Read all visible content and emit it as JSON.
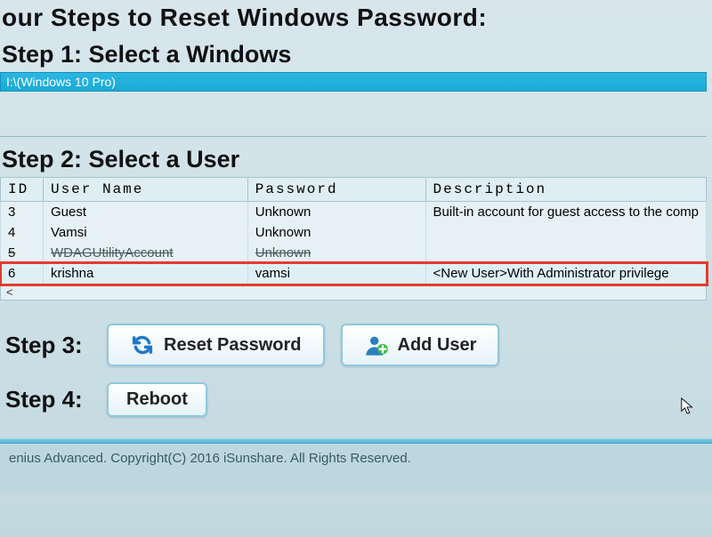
{
  "colors": {
    "accent": "#1aa9d6",
    "highlight_border": "#e53b2e"
  },
  "page_title": "our Steps to Reset Windows Password:",
  "step1": {
    "heading": "Step 1: Select a Windows",
    "partition": "I:\\(Windows 10 Pro)"
  },
  "step2": {
    "heading": "Step 2: Select a User",
    "columns": {
      "id": "ID",
      "user": "User Name",
      "password": "Password",
      "desc": "Description"
    },
    "rows": [
      {
        "id": "3",
        "user": "Guest",
        "password": "Unknown",
        "desc": "Built-in account for guest access to the comp"
      },
      {
        "id": "4",
        "user": "Vamsi",
        "password": "Unknown",
        "desc": ""
      },
      {
        "id": "5",
        "user": "WDAGUtilityAccount",
        "password": "Unknown",
        "desc": ""
      },
      {
        "id": "6",
        "user": "krishna",
        "password": "vamsi",
        "desc": "<New User>With Administrator privilege"
      }
    ],
    "highlight_row_index": 3,
    "scroll_caret": "<"
  },
  "step3": {
    "label": "Step 3:",
    "reset_label": "Reset Password",
    "adduser_label": "Add User"
  },
  "step4": {
    "label": "Step 4:",
    "reboot_label": "Reboot"
  },
  "footer": "enius Advanced. Copyright(C) 2016 iSunshare. All Rights Reserved."
}
